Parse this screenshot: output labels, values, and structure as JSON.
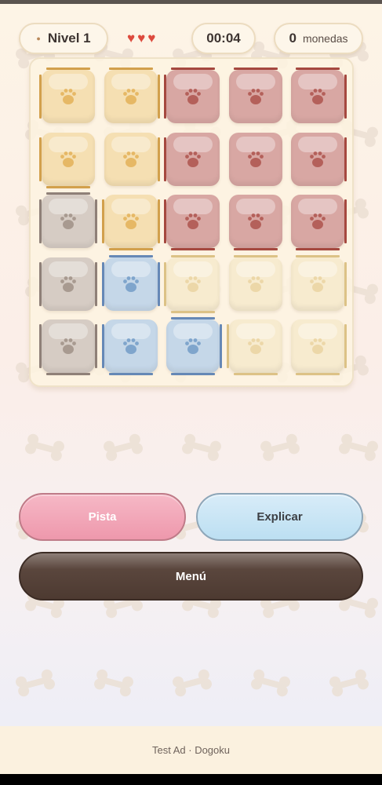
{
  "hud": {
    "level_label": "Nivel 1",
    "lives_count": 3,
    "lives_icon": "heart-icon",
    "timer": "00:04",
    "coins_count": "0",
    "coins_label": "monedas"
  },
  "board": {
    "rows": 5,
    "cols": 5,
    "cell_icon": "paw-icon",
    "cells": [
      [
        "yellow",
        "yellow",
        "red",
        "red",
        "red"
      ],
      [
        "yellow",
        "yellow",
        "red",
        "red",
        "red"
      ],
      [
        "gray",
        "yellow",
        "red",
        "red",
        "red"
      ],
      [
        "gray",
        "blue",
        "yellow-faded",
        "yellow-faded",
        "yellow-faded"
      ],
      [
        "gray",
        "blue",
        "blue",
        "yellow-faded",
        "yellow-faded"
      ]
    ],
    "colors": {
      "yellow": {
        "fill": "#f5dfb2",
        "paw": "#e6b865",
        "border": "#d2a04c"
      },
      "red": {
        "fill": "#d8a7a3",
        "paw": "#b4605a",
        "border": "#a5483f"
      },
      "gray": {
        "fill": "#d6ccc4",
        "paw": "#a89a90",
        "border": "#8f8078"
      },
      "blue": {
        "fill": "#c5d7e8",
        "paw": "#7fa5cc",
        "border": "#6688b6"
      },
      "yellow-faded": {
        "fill": "#f7ebcf",
        "paw": "#ecd7a8",
        "border": "#dcc286"
      }
    }
  },
  "buttons": {
    "hint": "Pista",
    "explain": "Explicar",
    "menu": "Menú"
  },
  "ad": {
    "text": "Test Ad · Dogoku"
  },
  "decor": {
    "background_icon": "bone-icon"
  }
}
